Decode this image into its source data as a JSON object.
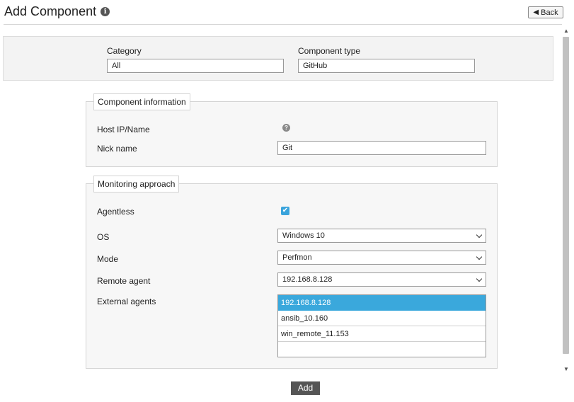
{
  "header": {
    "title": "Add Component",
    "info_icon": "i",
    "back_label": "Back",
    "back_icon": "arrow-left-icon"
  },
  "filters": {
    "category_label": "Category",
    "category_value": "All",
    "component_type_label": "Component type",
    "component_type_value": "GitHub"
  },
  "component_info": {
    "legend": "Component information",
    "host_label": "Host IP/Name",
    "help_icon": "?",
    "nick_label": "Nick name",
    "nick_value": "Git"
  },
  "monitoring": {
    "legend": "Monitoring approach",
    "agentless_label": "Agentless",
    "agentless_checked": true,
    "os_label": "OS",
    "os_value": "Windows 10",
    "mode_label": "Mode",
    "mode_value": "Perfmon",
    "remote_label": "Remote agent",
    "remote_value": "192.168.8.128",
    "external_label": "External agents",
    "external_agents": [
      "192.168.8.128",
      "ansib_10.160",
      "win_remote_11.153"
    ],
    "external_selected_index": 0
  },
  "footer": {
    "add_label": "Add"
  },
  "colors": {
    "accent": "#3aa8dc",
    "button_dark": "#555555"
  }
}
